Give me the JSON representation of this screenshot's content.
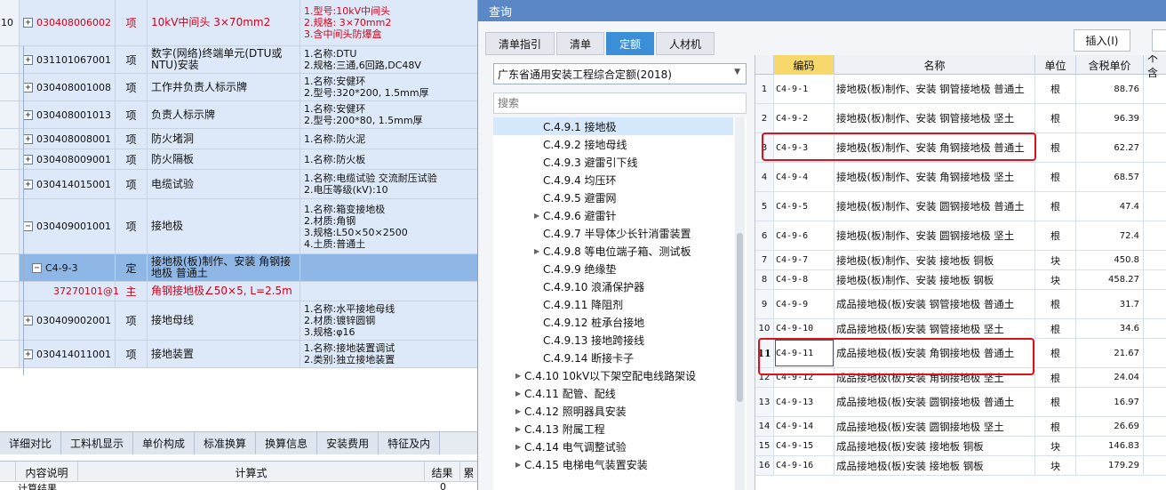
{
  "left_grid": {
    "rows": [
      {
        "idx": "10",
        "code": "030408006002",
        "type": "项",
        "name": "10kV中间头 3×70mm2",
        "feature": "1.型号:10kV中间头\n2.规格: 3×70mm2\n3.含中间头防爆盒",
        "red": true,
        "exp": "+"
      },
      {
        "idx": "",
        "code": "031101067001",
        "type": "项",
        "name": "数字(网络)终端单元(DTU或NTU)安装",
        "feature": "1.名称:DTU\n2.规格:三通,6回路,DC48V",
        "exp": "+"
      },
      {
        "idx": "",
        "code": "030408001008",
        "type": "项",
        "name": "工作井负责人标示牌",
        "feature": "1.名称:安健环\n2.型号:320*200, 1.5mm厚",
        "exp": "+"
      },
      {
        "idx": "",
        "code": "030408001013",
        "type": "项",
        "name": "负责人标示牌",
        "feature": "1.名称:安健环\n2.型号:200*80, 1.5mm厚",
        "exp": "+"
      },
      {
        "idx": "",
        "code": "030408008001",
        "type": "项",
        "name": "防火堵洞",
        "feature": "1.名称:防火泥",
        "exp": "+"
      },
      {
        "idx": "",
        "code": "030408009001",
        "type": "项",
        "name": "防火隔板",
        "feature": "1.名称:防火板",
        "exp": "+"
      },
      {
        "idx": "",
        "code": "030414015001",
        "type": "项",
        "name": "电缆试验",
        "feature": "1.名称:电缆试验 交流耐压试验\n2.电压等级(kV):10",
        "exp": "+"
      },
      {
        "idx": "",
        "code": "030409001001",
        "type": "项",
        "name": "接地极",
        "feature": "1.名称:箱变接地极\n2.材质:角钢\n3.规格:L50×50×2500\n4.土质:普通土",
        "exp": "−"
      },
      {
        "idx": "",
        "code": "C4-9-3",
        "type": "定",
        "name": "接地极(板)制作、安装 角钢接地极 普通土",
        "feature": "",
        "sel": true,
        "exp": "−"
      },
      {
        "idx": "",
        "code": "37270101@1",
        "type": "主",
        "name": "角钢接地极∠50×5, L=2.5m",
        "feature": "",
        "red": true
      },
      {
        "idx": "",
        "code": "030409002001",
        "type": "项",
        "name": "接地母线",
        "feature": "1.名称:水平接地母线\n2.材质:镀锌圆钢\n3.规格:φ16",
        "exp": "+"
      },
      {
        "idx": "",
        "code": "030414011001",
        "type": "项",
        "name": "接地装置",
        "feature": "1.名称:接地装置调试\n2.类别:独立接地装置",
        "exp": "+"
      }
    ],
    "bottom_tabs": [
      "详细对比",
      "工料机显示",
      "单价构成",
      "标准换算",
      "换算信息",
      "安装费用",
      "特征及内"
    ],
    "bottom_header": {
      "c1": "内容说明",
      "c2": "计算式",
      "c3": "结果",
      "c4": "累"
    },
    "bottom_row": {
      "label": "计算结果",
      "value": "0"
    }
  },
  "dialog": {
    "title": "查询",
    "tabs": [
      "清单指引",
      "清单",
      "定额",
      "人材机"
    ],
    "insert_label": "插入(I)",
    "quota_library": "广东省通用安装工程综合定额(2018)",
    "search_placeholder": "搜索",
    "tree": [
      {
        "label": "C.4.9.1 接地极",
        "level": 2,
        "hl": true
      },
      {
        "label": "C.4.9.2 接地母线",
        "level": 2
      },
      {
        "label": "C.4.9.3 避雷引下线",
        "level": 2
      },
      {
        "label": "C.4.9.4 均压环",
        "level": 2
      },
      {
        "label": "C.4.9.5 避雷网",
        "level": 2
      },
      {
        "label": "C.4.9.6 避雷针",
        "level": 2,
        "arrow": true
      },
      {
        "label": "C.4.9.7 半导体少长针消雷装置",
        "level": 2
      },
      {
        "label": "C.4.9.8 等电位端子箱、测试板",
        "level": 2,
        "arrow": true
      },
      {
        "label": "C.4.9.9 绝缘垫",
        "level": 2
      },
      {
        "label": "C.4.9.10 浪涌保护器",
        "level": 2
      },
      {
        "label": "C.4.9.11 降阻剂",
        "level": 2
      },
      {
        "label": "C.4.9.12 桩承台接地",
        "level": 2
      },
      {
        "label": "C.4.9.13 接地跨接线",
        "level": 2
      },
      {
        "label": "C.4.9.14 断接卡子",
        "level": 2
      },
      {
        "label": "C.4.10 10kV以下架空配电线路架设",
        "level": 1,
        "arrow": true
      },
      {
        "label": "C.4.11 配管、配线",
        "level": 1,
        "arrow": true
      },
      {
        "label": "C.4.12 照明器具安装",
        "level": 1,
        "arrow": true
      },
      {
        "label": "C.4.13 附属工程",
        "level": 1,
        "arrow": true
      },
      {
        "label": "C.4.14 电气调整试验",
        "level": 1,
        "arrow": true
      },
      {
        "label": "C.4.15 电梯电气装置安装",
        "level": 1,
        "arrow": true
      }
    ],
    "table": {
      "headers": {
        "code": "编码",
        "name": "名称",
        "unit": "单位",
        "price": "含税单价",
        "extra": "不含"
      },
      "rows": [
        {
          "n": "1",
          "code": "C4-9-1",
          "name": "接地极(板)制作、安装 钢管接地极 普通土",
          "unit": "根",
          "price": "88.76"
        },
        {
          "n": "2",
          "code": "C4-9-2",
          "name": "接地极(板)制作、安装 钢管接地极 坚土",
          "unit": "根",
          "price": "96.39"
        },
        {
          "n": "3",
          "code": "C4-9-3",
          "name": "接地极(板)制作、安装 角钢接地极 普通土",
          "unit": "根",
          "price": "62.27"
        },
        {
          "n": "4",
          "code": "C4-9-4",
          "name": "接地极(板)制作、安装 角钢接地极 坚土",
          "unit": "根",
          "price": "68.57"
        },
        {
          "n": "5",
          "code": "C4-9-5",
          "name": "接地极(板)制作、安装 圆钢接地极 普通土",
          "unit": "根",
          "price": "47.4"
        },
        {
          "n": "6",
          "code": "C4-9-6",
          "name": "接地极(板)制作、安装 圆钢接地极 坚土",
          "unit": "根",
          "price": "72.4"
        },
        {
          "n": "7",
          "code": "C4-9-7",
          "name": "接地极(板)制作、安装 接地板 铜板",
          "unit": "块",
          "price": "450.8"
        },
        {
          "n": "8",
          "code": "C4-9-8",
          "name": "接地极(板)制作、安装 接地板 钢板",
          "unit": "块",
          "price": "458.27"
        },
        {
          "n": "9",
          "code": "C4-9-9",
          "name": "成品接地极(板)安装 钢管接地极 普通土",
          "unit": "根",
          "price": "31.7"
        },
        {
          "n": "10",
          "code": "C4-9-10",
          "name": "成品接地极(板)安装 钢管接地极 坚土",
          "unit": "根",
          "price": "34.6"
        },
        {
          "n": "11",
          "code": "C4-9-11",
          "name": "成品接地极(板)安装 角钢接地极 普通土",
          "unit": "根",
          "price": "21.67",
          "cur": true
        },
        {
          "n": "12",
          "code": "C4-9-12",
          "name": "成品接地极(板)安装 角钢接地极 坚土",
          "unit": "根",
          "price": "24.04"
        },
        {
          "n": "13",
          "code": "C4-9-13",
          "name": "成品接地极(板)安装 圆钢接地极 普通土",
          "unit": "根",
          "price": "16.97"
        },
        {
          "n": "14",
          "code": "C4-9-14",
          "name": "成品接地极(板)安装 圆钢接地极 坚土",
          "unit": "根",
          "price": "26.69"
        },
        {
          "n": "15",
          "code": "C4-9-15",
          "name": "成品接地极(板)安装 接地板 铜板",
          "unit": "块",
          "price": "146.83"
        },
        {
          "n": "16",
          "code": "C4-9-16",
          "name": "成品接地极(板)安装 接地板 钢板",
          "unit": "块",
          "price": "179.29"
        }
      ]
    }
  }
}
